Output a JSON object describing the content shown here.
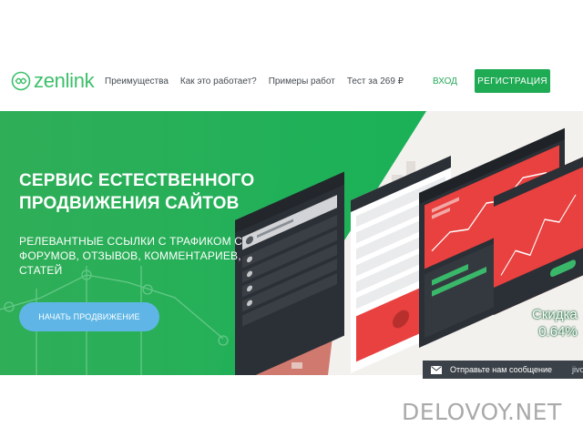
{
  "header": {
    "logo_text": "zenlink",
    "nav": [
      "Преимущества",
      "Как это работает?",
      "Примеры работ",
      "Тест за 269 ₽"
    ],
    "login_label": "ВХОД",
    "register_label": "РЕГИСТРАЦИЯ"
  },
  "hero": {
    "title": "СЕРВИС ЕСТЕСТВЕННОГО ПРОДВИЖЕНИЯ САЙТОВ",
    "subtitle": "РЕЛЕВАНТНЫЕ ССЫЛКИ С ТРАФИКОМ С ФОРУМОВ, ОТЗЫВОВ, КОММЕНТАРИЕВ, СТАТЕЙ",
    "cta_label": "НАЧАТЬ ПРОДВИЖЕНИЕ",
    "discount_label": "Скидка",
    "discount_value": "0.64%"
  },
  "chat": {
    "label": "Отправьте нам сообщение",
    "brand": "jivo"
  },
  "watermark": "DELOVOY.NET",
  "colors": {
    "brand_green": "#1faa54",
    "logo_green": "#3cbf6a",
    "cta_blue": "#5fb6e6",
    "mockup_red": "#e8413f",
    "dark_panel": "#2b2f36"
  }
}
